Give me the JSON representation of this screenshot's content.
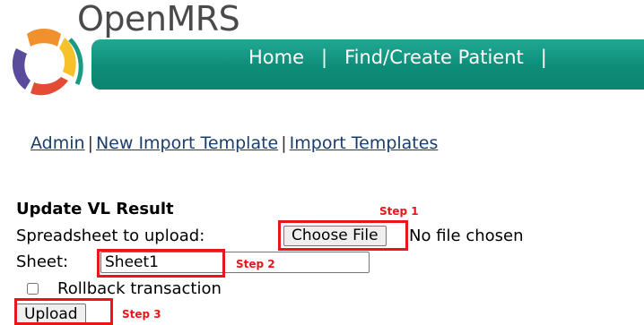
{
  "header": {
    "app_title": "OpenMRS",
    "logo_icon": "openmrs-logo-icon",
    "nav": {
      "home": "Home",
      "separator_1": "|",
      "find_create_patient": "Find/Create Patient",
      "separator_2": "|"
    },
    "colors": {
      "nav_bar": "#0d8d79",
      "nav_text": "#ffffff"
    }
  },
  "admin_links": {
    "admin": "Admin",
    "separator_1": "|",
    "new_import_template": "New Import Template",
    "separator_2": "|",
    "import_templates": "Import Templates"
  },
  "form": {
    "title": "Update VL Result",
    "upload_label": "Spreadsheet to upload:",
    "choose_file_label": "Choose File",
    "file_status": "No file chosen",
    "sheet_label": "Sheet:",
    "sheet_value": "Sheet1",
    "rollback_label": "Rollback transaction",
    "rollback_checked": false,
    "upload_button": "Upload"
  },
  "annotations": {
    "step_1": "Step 1",
    "step_2": "Step 2",
    "step_3": "Step 3",
    "color": "#e8151b"
  }
}
